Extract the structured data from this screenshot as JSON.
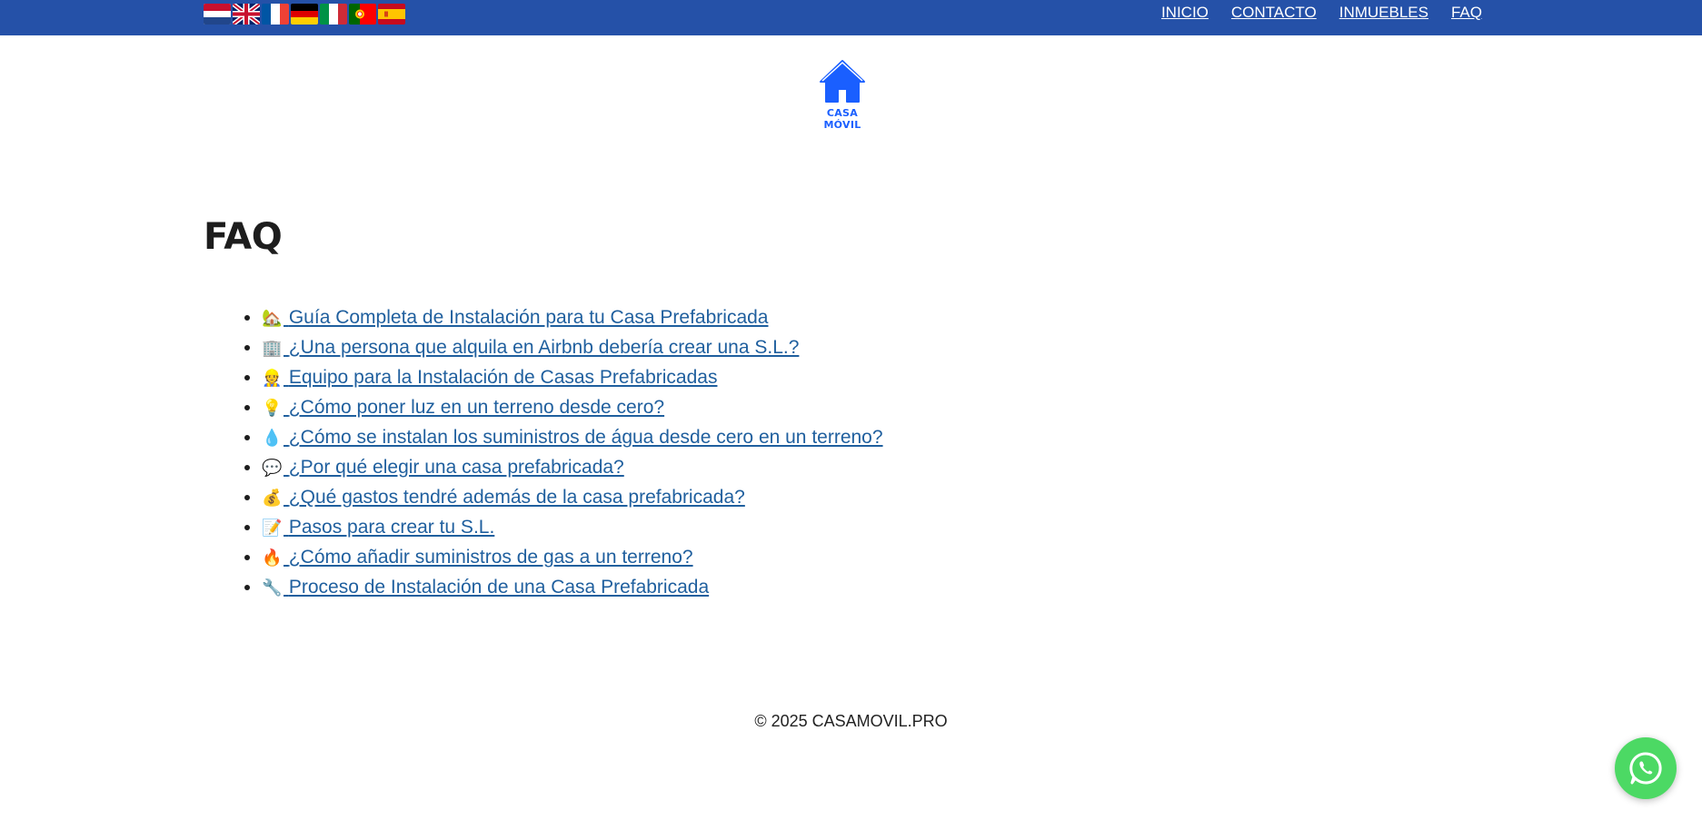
{
  "header": {
    "bg_color": "#2551a8",
    "languages": [
      {
        "code": "nl",
        "icon": "netherlands-flag-icon"
      },
      {
        "code": "en",
        "icon": "uk-flag-icon"
      },
      {
        "code": "fr",
        "icon": "france-flag-icon"
      },
      {
        "code": "de",
        "icon": "germany-flag-icon"
      },
      {
        "code": "it",
        "icon": "italy-flag-icon"
      },
      {
        "code": "pt",
        "icon": "portugal-flag-icon"
      },
      {
        "code": "es",
        "icon": "spain-flag-icon"
      }
    ],
    "nav": [
      {
        "label": "INICIO"
      },
      {
        "label": "CONTACTO"
      },
      {
        "label": "INMUEBLES"
      },
      {
        "label": "FAQ"
      }
    ]
  },
  "logo": {
    "text": "CASA MÓVIL",
    "icon": "house-icon",
    "color": "#1a5fff"
  },
  "main": {
    "title": "FAQ",
    "items": [
      {
        "emoji": "🏡",
        "label": "Guía Completa de Instalación para tu Casa Prefabricada"
      },
      {
        "emoji": "🏢",
        "label": "¿Una persona que alquila en Airbnb debería crear una S.L.?"
      },
      {
        "emoji": "👷",
        "label": "Equipo para la Instalación de Casas Prefabricadas"
      },
      {
        "emoji": "💡",
        "label": "¿Cómo poner luz en un terreno desde cero?"
      },
      {
        "emoji": "💧",
        "label": "¿Cómo se instalan los suministros de água desde cero en un terreno?"
      },
      {
        "emoji": "💬",
        "label": "¿Por qué elegir una casa prefabricada?"
      },
      {
        "emoji": "💰",
        "label": "¿Qué gastos tendré además de la casa prefabricada?"
      },
      {
        "emoji": "📝",
        "label": "Pasos para crear tu S.L."
      },
      {
        "emoji": "🔥",
        "label": "¿Cómo añadir suministros de gas a un terreno?"
      },
      {
        "emoji": "🔧",
        "label": "Proceso de Instalación de una Casa Prefabricada"
      }
    ],
    "link_color": "#1f5f9e"
  },
  "footer": {
    "text": "© 2025 CASAMOVIL.PRO"
  },
  "whatsapp": {
    "icon": "whatsapp-icon",
    "color": "#4cd964"
  }
}
